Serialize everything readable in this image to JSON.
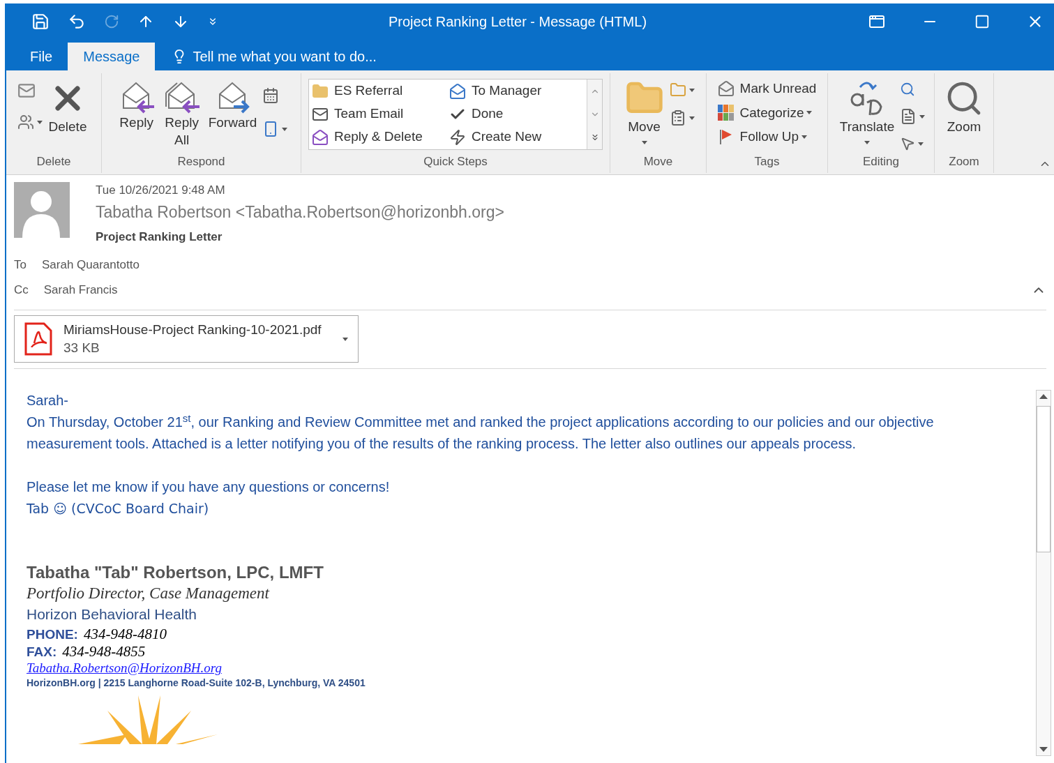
{
  "window": {
    "title": "Project Ranking Letter - Message (HTML)"
  },
  "tabs": [
    {
      "label": "File",
      "selected": false
    },
    {
      "label": "Message",
      "selected": true
    }
  ],
  "tell_me": "Tell me what you want to do...",
  "ribbon": {
    "groups": [
      {
        "label": "Delete",
        "buttons": [
          "Delete"
        ]
      },
      {
        "label": "Respond",
        "buttons": [
          "Reply",
          "Reply All",
          "Forward"
        ]
      },
      {
        "label": "Quick Steps",
        "buttons": [
          "ES Referral",
          "Team Email",
          "Reply & Delete",
          "To Manager",
          "Done",
          "Create New"
        ]
      },
      {
        "label": "Move",
        "buttons": [
          "Move"
        ]
      },
      {
        "label": "Tags",
        "buttons": [
          "Mark Unread",
          "Categorize",
          "Follow Up"
        ]
      },
      {
        "label": "Editing",
        "buttons": [
          "Translate"
        ]
      },
      {
        "label": "Zoom",
        "buttons": [
          "Zoom"
        ]
      }
    ]
  },
  "message": {
    "date": "Tue 10/26/2021 9:48 AM",
    "from": "Tabatha Robertson <Tabatha.Robertson@horizonbh.org>",
    "subject": "Project Ranking Letter",
    "to_label": "To",
    "to": "Sarah Quarantotto",
    "cc_label": "Cc",
    "cc": "Sarah Francis"
  },
  "attachment": {
    "name": "MiriamsHouse-Project Ranking-10-2021.pdf",
    "size": "33 KB"
  },
  "body": {
    "greeting": "Sarah-",
    "paragraph": "On Thursday, October 21$^{st}$, our Ranking and Review Committee met and ranked the project applications according to our policies and our objective measurement tools.  Attached is a letter notifying you of the results of the ranking process. The letter also outlines our appeals process.",
    "closing": "Please let me know if you have any questions or concerns!",
    "signoff": "Tab ☺ (CVCoC Board Chair)"
  },
  "signature": {
    "name": "Tabatha \"Tab\" Robertson, LPC, LMFT",
    "title": "Portfolio Director, Case Management",
    "org": "Horizon Behavioral Health",
    "phone_label": "PHONE:",
    "phone": "434-948-4810",
    "fax_label": "FAX:",
    "fax": "434-948-4855",
    "email": "Tabatha.Robertson@HorizonBH.org",
    "address": "HorizonBH.org | 2215 Langhorne Road-Suite 102-B, Lynchburg, VA 24501"
  }
}
